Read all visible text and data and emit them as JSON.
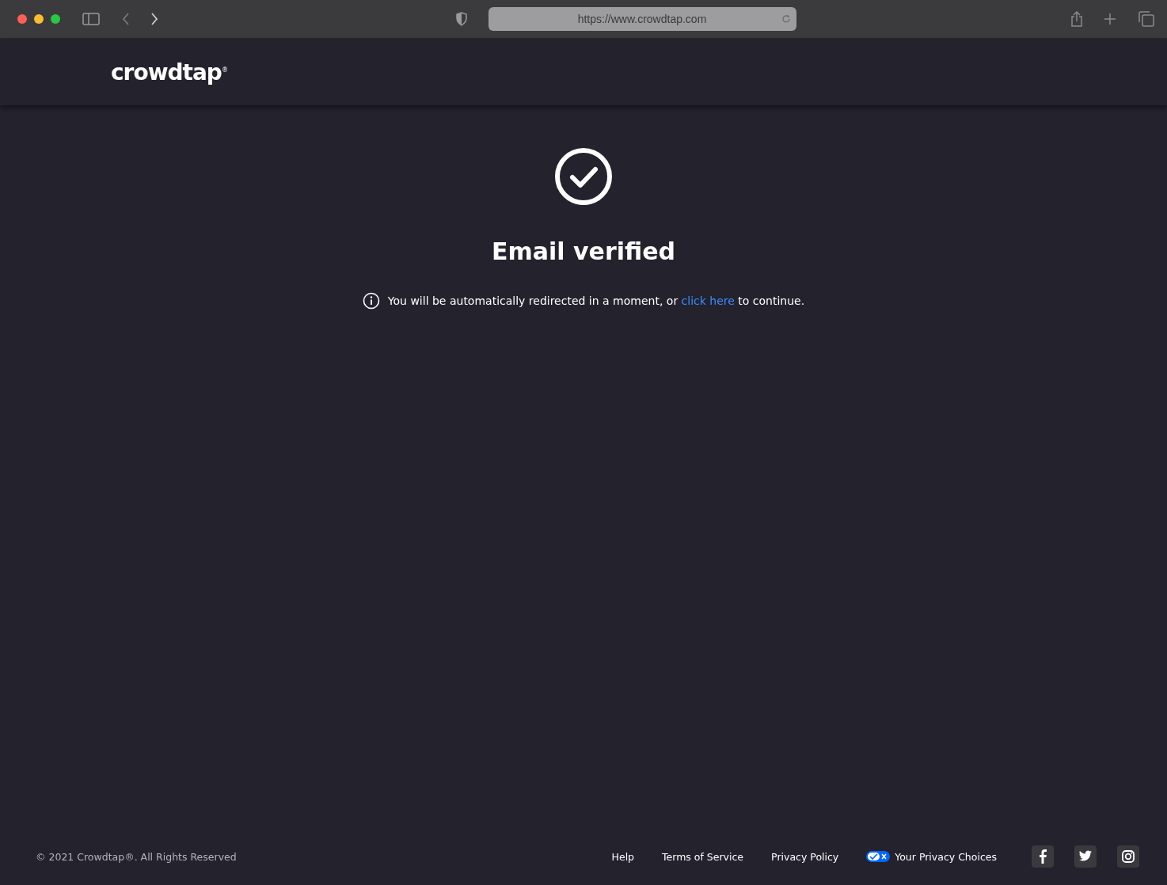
{
  "browser": {
    "url": "https://www.crowdtap.com"
  },
  "header": {
    "logo": "crowdtap$^{®}$"
  },
  "main": {
    "title": "Email verified",
    "message_before": "You will be automatically redirected in a moment, or ",
    "link": "click here",
    "message_after": " to continue."
  },
  "footer": {
    "copyright": "© 2021 Crowdtap®. All Rights Reserved",
    "links": [
      {
        "label": "Help",
        "kind": "plain"
      },
      {
        "label": "Terms of Service",
        "kind": "plain"
      },
      {
        "label": "Privacy Policy",
        "kind": "plain"
      },
      {
        "label": "Your Privacy Choices",
        "kind": "privacy"
      }
    ],
    "social": [
      {
        "kind": "facebook"
      },
      {
        "kind": "twitter"
      },
      {
        "kind": "instagram"
      }
    ]
  }
}
